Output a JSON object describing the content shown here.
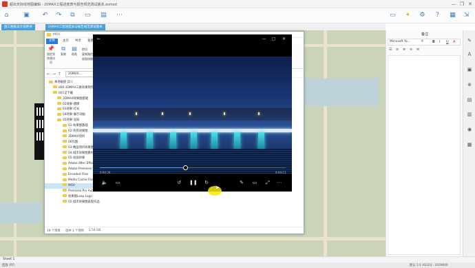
{
  "app": {
    "title": "超出天际线地图编辑 - 20MAX工程进度表与报告规范测试版本.esmod",
    "window_controls": [
      "—",
      "❐",
      "✕"
    ]
  },
  "tabs": [
    {
      "label": "施工图纸设计说明书"
    },
    {
      "label": "20MAX工程进度表与报告规范测试版本"
    }
  ],
  "explorer": {
    "title": "MOV",
    "ribbon_tabs": [
      "文件",
      "主页",
      "共享",
      "查看"
    ],
    "ribbon_buttons": [
      "固定到快速访问",
      "复制",
      "粘贴",
      "剪切",
      "复制路径",
      "粘贴快捷方式"
    ],
    "address": "20MAX...",
    "tree": [
      "本地磁盘 (D:)",
      "000-3DMAX三维效果制作",
      "001记下载",
      "3DMAX效果图基础",
      "02效果-建模",
      "03效果-灯光",
      "04效果-展示动画",
      "05效果-渲染",
      "01-效果图基础",
      "02-项目效果图",
      "3DMAX项目",
      "06作图",
      "03-精品项目效果图",
      "04-城市效果图素材",
      "05-动画效果",
      "Adobe After Effects",
      "Adobe Premiere Pro",
      "Encoded Files",
      "Media Cache Files",
      "MOV",
      "Premiere Pro Auto-Save",
      "效果图Loop Logo",
      "05-城市效果图表现作品"
    ],
    "selected_index": 19,
    "status": [
      "19 个项目",
      "选中 1 个项目",
      "1.54 GB"
    ]
  },
  "player": {
    "time_left": "0:00:29",
    "time_right": "0:00:11",
    "progress": 0.46,
    "controls": [
      "volume",
      "subtitles",
      "rewind-10",
      "pause",
      "forward-30",
      "edit",
      "cast",
      "fullscreen",
      "more"
    ]
  },
  "right_panel": {
    "title": "备注",
    "font_name": "Microsoft Ya...",
    "font_size": "9",
    "format_buttons": [
      "B",
      "I",
      "U",
      "A"
    ]
  },
  "sheetbar": {
    "label": "Sheet 1"
  },
  "statusbar": {
    "left": "回放 (RT)",
    "right": "默认  1:1  AGI2I3 · 2429000"
  },
  "colors": {
    "accent": "#2b7bd3",
    "tab_active": "#4aa0dc",
    "canvas": "#c9d4b8",
    "highlight": "#ffe600"
  }
}
